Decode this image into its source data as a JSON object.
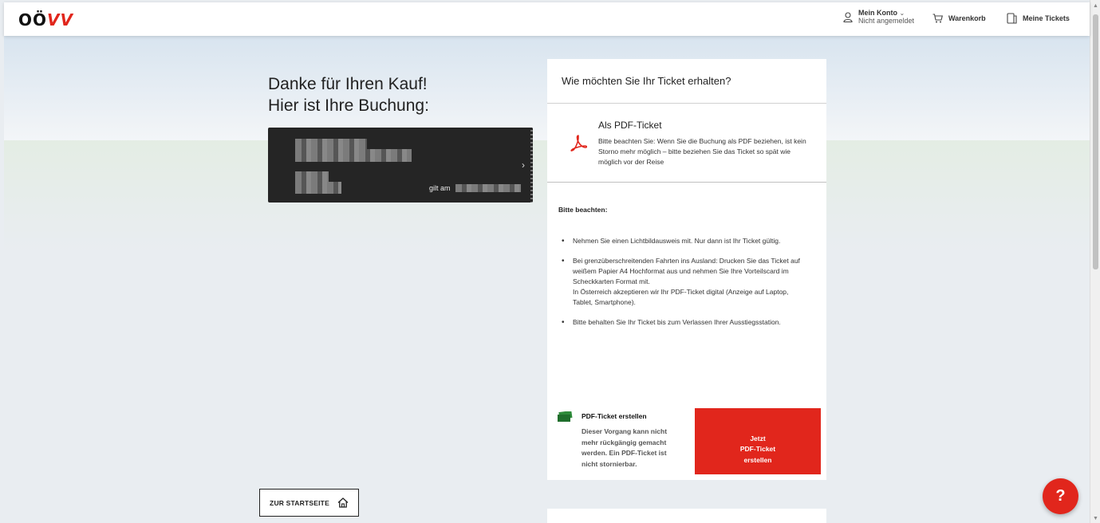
{
  "header": {
    "logo_main": "OÖ",
    "logo_accent": "VV",
    "account_label": "Mein Konto",
    "account_status": "Nicht angemeldet",
    "cart_label": "Warenkorb",
    "tickets_label": "Meine Tickets"
  },
  "main": {
    "thanks_line1": "Danke für Ihren Kauf!",
    "thanks_line2": "Hier ist Ihre Buchung:",
    "ticket_valid_prefix": "gilt am"
  },
  "panel": {
    "question": "Wie möchten Sie Ihr Ticket erhalten?",
    "pdf_option_title": "Als PDF-Ticket",
    "pdf_option_note": "Bitte beachten Sie: Wenn Sie die Buchung als PDF beziehen, ist kein Storno mehr möglich – bitte beziehen Sie das Ticket so spät wie möglich vor der Reise",
    "notice_heading": "Bitte beachten:",
    "notices": [
      "Nehmen Sie einen Lichtbildausweis mit. Nur dann ist Ihr Ticket gültig.",
      "Bei grenzüberschreitenden Fahrten ins Ausland: Drucken Sie das Ticket auf weißem Papier A4 Hochformat aus und nehmen Sie Ihre Vorteilscard im Scheckkarten Format mit.\nIn Österreich akzeptieren wir Ihr PDF-Ticket digital (Anzeige auf Laptop, Tablet, Smartphone).",
      "Bitte behalten Sie Ihr Ticket bis zum Verlassen Ihrer Ausstiegsstation."
    ],
    "create_title": "PDF-Ticket erstellen",
    "create_note": "Dieser Vorgang kann nicht mehr rückgängig gemacht werden. Ein PDF-Ticket ist nicht stornierbar.",
    "create_button": "Jetzt\nPDF-Ticket\nerstellen"
  },
  "footer": {
    "home_button": "ZUR STARTSEITE",
    "help_label": "?"
  },
  "colors": {
    "brand_red": "#e1261c",
    "ticket_dark": "#252525",
    "create_icon_green": "#2e8b3a"
  }
}
